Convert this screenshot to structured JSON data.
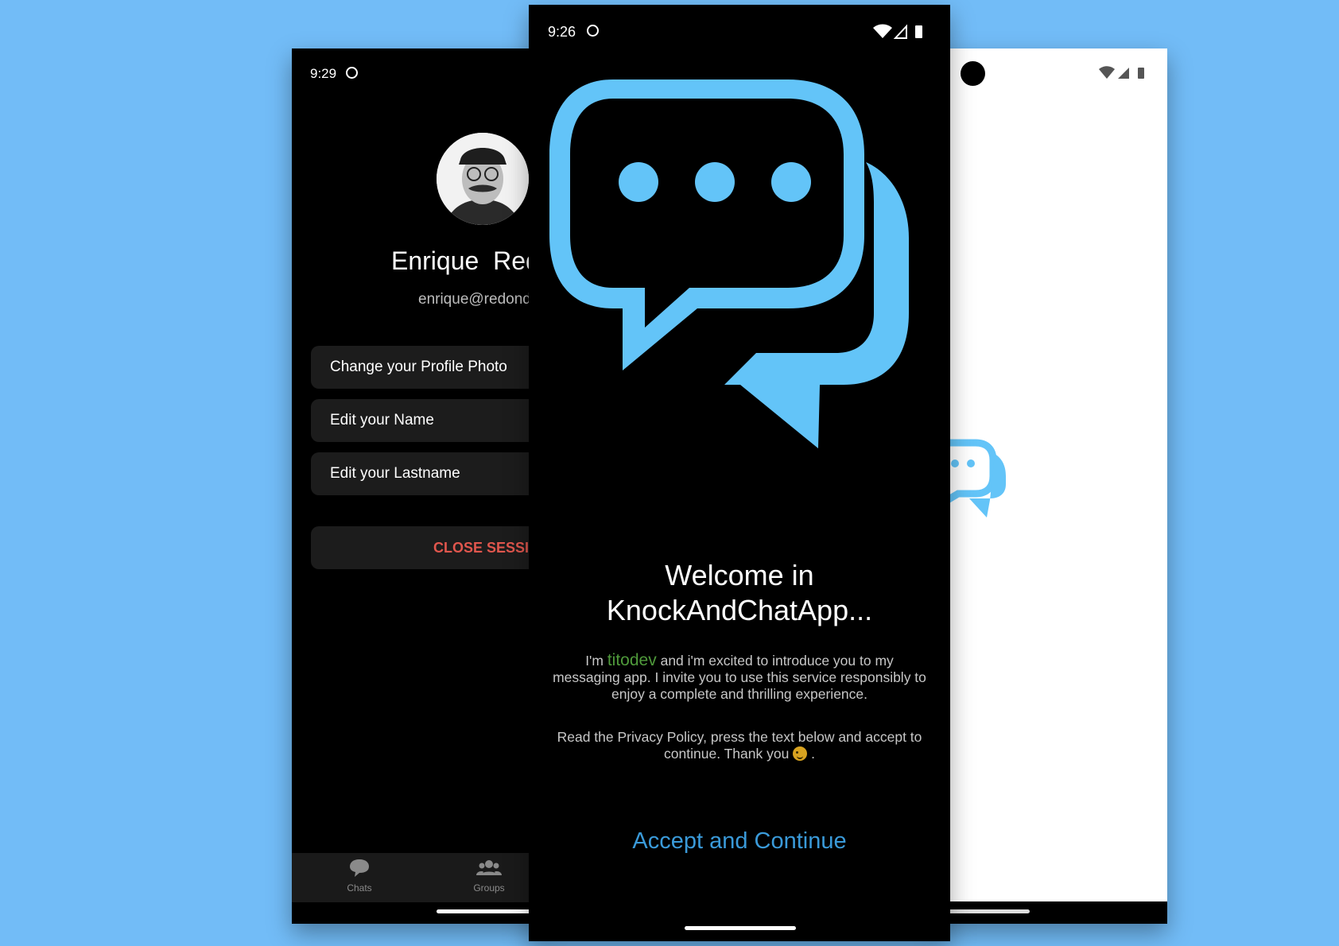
{
  "colors": {
    "background": "#72bcf7",
    "accent_blue": "#63c4f8",
    "link_blue": "#3a9ad9",
    "danger_red": "#e0564d",
    "brand_green": "#4f9a3b"
  },
  "left_screen": {
    "status_time": "9:29",
    "profile_name": "Enrique  Red",
    "profile_email": "enrique@redond",
    "menu": {
      "change_photo": "Change your Profile Photo",
      "edit_name": "Edit your Name",
      "edit_lastname": "Edit your Lastname"
    },
    "close_session": "CLOSE SESSIO",
    "nav": [
      {
        "label": "Chats",
        "icon": "chat-bubble-icon"
      },
      {
        "label": "Groups",
        "icon": "group-icon"
      }
    ]
  },
  "center_screen": {
    "status_time": "9:26",
    "welcome_line1": "Welcome in",
    "welcome_line2": "KnockAndChatApp...",
    "intro_prefix": "I'm ",
    "intro_brand": "titodev",
    "intro_rest": " and i'm excited to introduce you to my messaging app. I invite you to use this service responsibly to enjoy a complete and thrilling experience.",
    "policy_text": "Read the Privacy Policy, press the text below and accept to continue. Thank you",
    "policy_end": " .",
    "accept_button": "Accept and Continue"
  }
}
